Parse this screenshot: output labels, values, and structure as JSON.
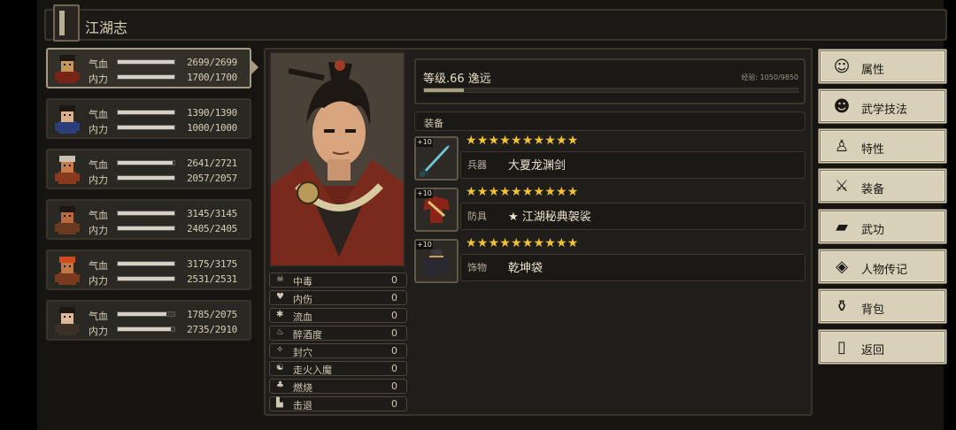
{
  "title": "江湖志",
  "party": [
    {
      "hp_label": "气血",
      "mp_label": "内力",
      "hp": "2699/2699",
      "mp": "1700/1700",
      "hp_ratio": 1.0,
      "mp_ratio": 1.0,
      "active": true
    },
    {
      "hp_label": "气血",
      "mp_label": "内力",
      "hp": "1390/1390",
      "mp": "1000/1000",
      "hp_ratio": 1.0,
      "mp_ratio": 1.0,
      "active": false
    },
    {
      "hp_label": "气血",
      "mp_label": "内力",
      "hp": "2641/2721",
      "mp": "2057/2057",
      "hp_ratio": 0.97,
      "mp_ratio": 1.0,
      "active": false
    },
    {
      "hp_label": "气血",
      "mp_label": "内力",
      "hp": "3145/3145",
      "mp": "2405/2405",
      "hp_ratio": 1.0,
      "mp_ratio": 1.0,
      "active": false
    },
    {
      "hp_label": "气血",
      "mp_label": "内力",
      "hp": "3175/3175",
      "mp": "2531/2531",
      "hp_ratio": 1.0,
      "mp_ratio": 1.0,
      "active": false
    },
    {
      "hp_label": "气血",
      "mp_label": "内力",
      "hp": "1785/2075",
      "mp": "2735/2910",
      "hp_ratio": 0.86,
      "mp_ratio": 0.94,
      "active": false
    }
  ],
  "character": {
    "level_text": "等级.66 逸远",
    "xp_text": "经验: 1050/9850",
    "xp_ratio": 0.106
  },
  "equipment": {
    "header": "装备",
    "items": [
      {
        "plus": "+10",
        "stars": "★★★★★★★★★★",
        "type": "兵器",
        "name": "大夏龙渊剑",
        "icon": "sword-icon"
      },
      {
        "plus": "+10",
        "stars": "★★★★★★★★★★",
        "type": "防具",
        "name": "★ 江湖秘典袈裟",
        "icon": "robe-icon"
      },
      {
        "plus": "+10",
        "stars": "★★★★★★★★★★",
        "type": "饰物",
        "name": "乾坤袋",
        "icon": "bag-icon"
      }
    ]
  },
  "status": [
    {
      "name": "中毒",
      "value": "0",
      "icon": "skull-icon"
    },
    {
      "name": "内伤",
      "value": "0",
      "icon": "broken-heart-icon"
    },
    {
      "name": "流血",
      "value": "0",
      "icon": "blood-drop-icon"
    },
    {
      "name": "醉酒度",
      "value": "0",
      "icon": "wine-icon"
    },
    {
      "name": "封穴",
      "value": "0",
      "icon": "acupoint-icon"
    },
    {
      "name": "走火入魔",
      "value": "0",
      "icon": "demon-icon"
    },
    {
      "name": "燃烧",
      "value": "0",
      "icon": "fire-icon"
    },
    {
      "name": "击退",
      "value": "0",
      "icon": "knockback-icon"
    }
  ],
  "menu": [
    {
      "label": "属性",
      "icon": "person-icon"
    },
    {
      "label": "武学技法",
      "icon": "martial-icon"
    },
    {
      "label": "特性",
      "icon": "trait-icon"
    },
    {
      "label": "装备",
      "icon": "sword-icon"
    },
    {
      "label": "武功",
      "icon": "scroll-icon"
    },
    {
      "label": "人物传记",
      "icon": "biography-icon"
    },
    {
      "label": "背包",
      "icon": "bag-icon"
    },
    {
      "label": "返回",
      "icon": "door-icon"
    }
  ],
  "colors": {
    "star": "#f1c232",
    "menu_bg": "#d8d0b8",
    "panel_bg": "#201e1a",
    "bar_fill": "#d6d1c4"
  }
}
